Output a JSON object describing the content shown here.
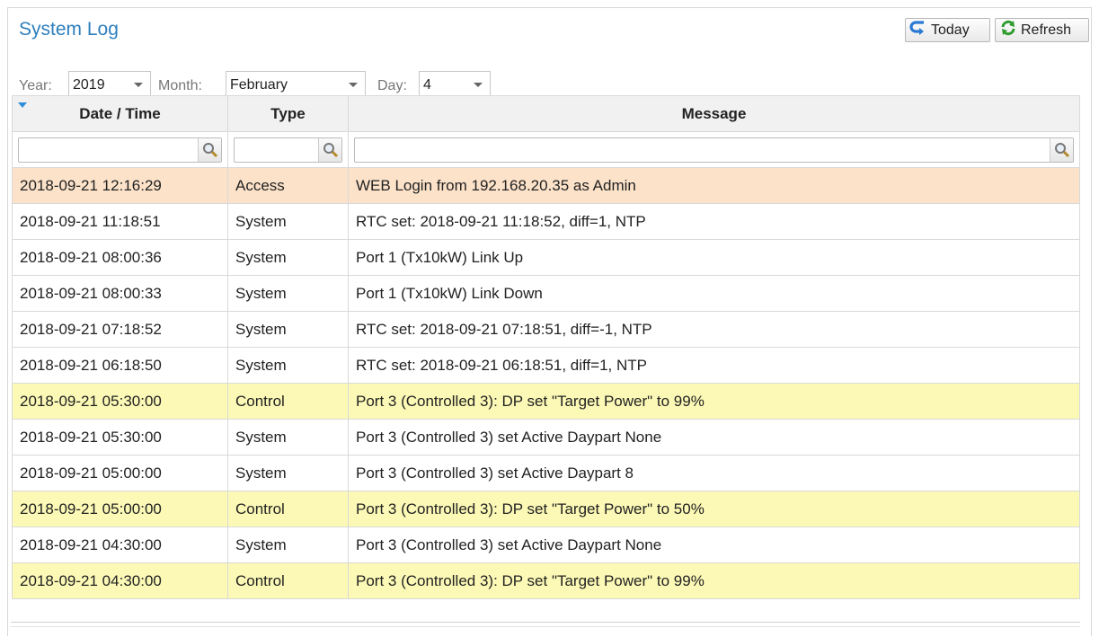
{
  "header": {
    "title": "System Log",
    "today_label": "Today",
    "refresh_label": "Refresh"
  },
  "filters": {
    "year_label": "Year:",
    "year_value": "2019",
    "month_label": "Month:",
    "month_value": "February",
    "day_label": "Day:",
    "day_value": "4"
  },
  "table": {
    "columns": [
      "Date / Time",
      "Type",
      "Message"
    ],
    "filter_values": [
      "",
      "",
      ""
    ],
    "rows": [
      {
        "datetime": "2018-09-21 12:16:29",
        "type": "Access",
        "message": "WEB Login from 192.168.20.35 as Admin"
      },
      {
        "datetime": "2018-09-21 11:18:51",
        "type": "System",
        "message": "RTC set: 2018-09-21 11:18:52, diff=1, NTP"
      },
      {
        "datetime": "2018-09-21 08:00:36",
        "type": "System",
        "message": "Port 1 (Tx10kW) Link Up"
      },
      {
        "datetime": "2018-09-21 08:00:33",
        "type": "System",
        "message": "Port 1 (Tx10kW) Link Down"
      },
      {
        "datetime": "2018-09-21 07:18:52",
        "type": "System",
        "message": "RTC set: 2018-09-21 07:18:51, diff=-1, NTP"
      },
      {
        "datetime": "2018-09-21 06:18:50",
        "type": "System",
        "message": "RTC set: 2018-09-21 06:18:51, diff=1, NTP"
      },
      {
        "datetime": "2018-09-21 05:30:00",
        "type": "Control",
        "message": "Port 3 (Controlled 3): DP set \"Target Power\" to 99%"
      },
      {
        "datetime": "2018-09-21 05:30:00",
        "type": "System",
        "message": "Port 3 (Controlled 3) set Active Daypart None"
      },
      {
        "datetime": "2018-09-21 05:00:00",
        "type": "System",
        "message": "Port 3 (Controlled 3) set Active Daypart 8"
      },
      {
        "datetime": "2018-09-21 05:00:00",
        "type": "Control",
        "message": "Port 3 (Controlled 3): DP set \"Target Power\" to 50%"
      },
      {
        "datetime": "2018-09-21 04:30:00",
        "type": "System",
        "message": "Port 3 (Controlled 3) set Active Daypart None"
      },
      {
        "datetime": "2018-09-21 04:30:00",
        "type": "Control",
        "message": "Port 3 (Controlled 3): DP set \"Target Power\" to 99%"
      }
    ]
  },
  "colors": {
    "title": "#2e7fbd",
    "access_row": "#fce2c9",
    "control_row": "#fcf9b6",
    "header_bg": "#f1f1f1"
  },
  "icons": {
    "today": "undo-arrow-icon",
    "refresh": "refresh-icon",
    "search": "magnifier-icon",
    "sort": "sort-desc-icon"
  }
}
